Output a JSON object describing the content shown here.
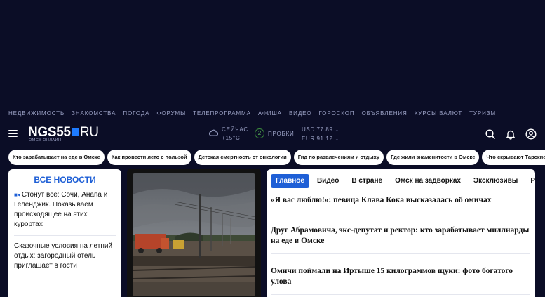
{
  "top_nav": [
    "Недвижимость",
    "Знакомства",
    "Погода",
    "Форумы",
    "Телепрограмма",
    "Афиша",
    "Видео",
    "Гороскоп",
    "Объявления",
    "Курсы валют",
    "Туризм"
  ],
  "header": {
    "logo_main": "NGS55",
    "logo_ru": "RU",
    "logo_sub": "Омск онлайн",
    "weather_label": "Сейчас",
    "weather_temp": "+15°C",
    "traffic_score": "2",
    "traffic_label": "Пробки",
    "usd": "USD 77.89",
    "eur": "EUR 91.12",
    "icons": [
      "menu-icon",
      "search-icon",
      "bell-icon",
      "user-icon",
      "cloud-icon"
    ]
  },
  "tags": [
    "Кто зарабатывает на еде в Омске",
    "Как провести лето с пользой",
    "Детская смертность от онкологии",
    "Гид по развлечениям и отдыху",
    "Где жили знаменитости в Омске",
    "Что скрывают Тарские вор"
  ],
  "news": {
    "title": "Все новости",
    "items": [
      "Стонут все: Сочи, Анапа и Геленджик. Показываем происходящее на этих курортах",
      "Сказочные условия на летний отдых: загородный отель приглашает в гости"
    ]
  },
  "main": {
    "tabs": [
      "Главное",
      "Видео",
      "В стране",
      "Омск на задворках",
      "Эксклюзивы",
      "Репортаж"
    ],
    "headlines": [
      "«Я вас люблю!»: певица Клава Кока высказалась об омичах",
      "Друг Абрамовича, экс-депутат и ректор: кто зарабатывает миллиарды на еде в Омске",
      "Омичи поймали на Иртыше 15 килограммов щуки: фото богатого улова"
    ]
  },
  "colors": {
    "background": "#0b0d26",
    "accent": "#1e5fd6",
    "logo_square": "#1e7bff",
    "traffic": "#3c8f3c"
  }
}
